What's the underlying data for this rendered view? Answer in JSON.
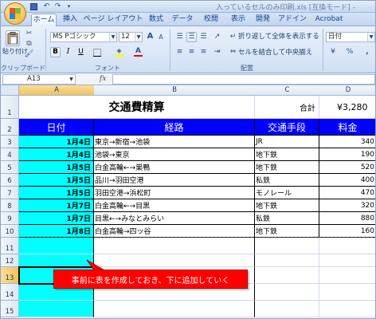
{
  "window": {
    "title": "入っているセルのみ印刷.xls [互換モード] -"
  },
  "quick_access": {
    "save_icon": "save-icon",
    "undo_glyph": "↶",
    "redo_glyph": "↷",
    "more_glyph": "▾"
  },
  "tabs": [
    "ホーム",
    "挿入",
    "ページ レイアウト",
    "数式",
    "データ",
    "校閲",
    "表示",
    "開発",
    "アドイン",
    "Acrobat"
  ],
  "active_tab": "ホーム",
  "ribbon": {
    "clipboard": {
      "paste_label": "貼り付け",
      "group_label": "クリップボード"
    },
    "font": {
      "font_name": "MS Pゴシック",
      "font_size": "12",
      "grow_glyph": "A",
      "shrink_glyph": "A",
      "bold": "B",
      "italic": "I",
      "underline": "U",
      "font_color_glyph": "A",
      "fill_color": "#ffff00",
      "font_color": "#ff0000",
      "group_label": "フォント"
    },
    "alignment": {
      "wrap_text": "折り返して全体を表示する",
      "merge_center": "セルを結合して中央揃え",
      "group_label": "配置"
    },
    "number": {
      "format": "日付",
      "percent": "%",
      "comma": ","
    }
  },
  "formula_bar": {
    "name_box": "A13",
    "fx": "fx",
    "value": ""
  },
  "columns": [
    "A",
    "B",
    "C",
    "D"
  ],
  "selected_column": "A",
  "rows": [
    "1",
    "2",
    "3",
    "4",
    "5",
    "6",
    "7",
    "8",
    "9",
    "10",
    "11",
    "12",
    "13",
    "14",
    "15"
  ],
  "selected_row": "13",
  "sheet": {
    "title": "交通費精算",
    "total_label": "合計",
    "total_value": "¥3,280",
    "headers": [
      "日付",
      "経路",
      "交通手段",
      "料金"
    ],
    "records": [
      {
        "date": "1月4日",
        "route": "東京→新宿→池袋",
        "means": "JR",
        "fare": "340"
      },
      {
        "date": "1月4日",
        "route": "池袋→東京",
        "means": "地下鉄",
        "fare": "190"
      },
      {
        "date": "1月5日",
        "route": "白金高輪←→巣鴨",
        "means": "地下鉄",
        "fare": "520"
      },
      {
        "date": "1月5日",
        "route": "品川→羽田空港",
        "means": "私鉄",
        "fare": "400"
      },
      {
        "date": "1月5日",
        "route": "羽田空港→浜松町",
        "means": "モノレール",
        "fare": "470"
      },
      {
        "date": "1月7日",
        "route": "白金高輪←→目黒",
        "means": "地下鉄",
        "fare": "320"
      },
      {
        "date": "1月7日",
        "route": "目黒←→みなとみらい",
        "means": "私鉄",
        "fare": "880"
      },
      {
        "date": "1月8日",
        "route": "白金高輪→四ッ谷",
        "means": "地下鉄",
        "fare": "160"
      }
    ]
  },
  "callout": {
    "text": "事前に表を作成しておき、下に追加していく",
    "color": "#ff0000"
  },
  "colors": {
    "header_fill": "#0000ff",
    "date_fill": "#00ffff"
  }
}
